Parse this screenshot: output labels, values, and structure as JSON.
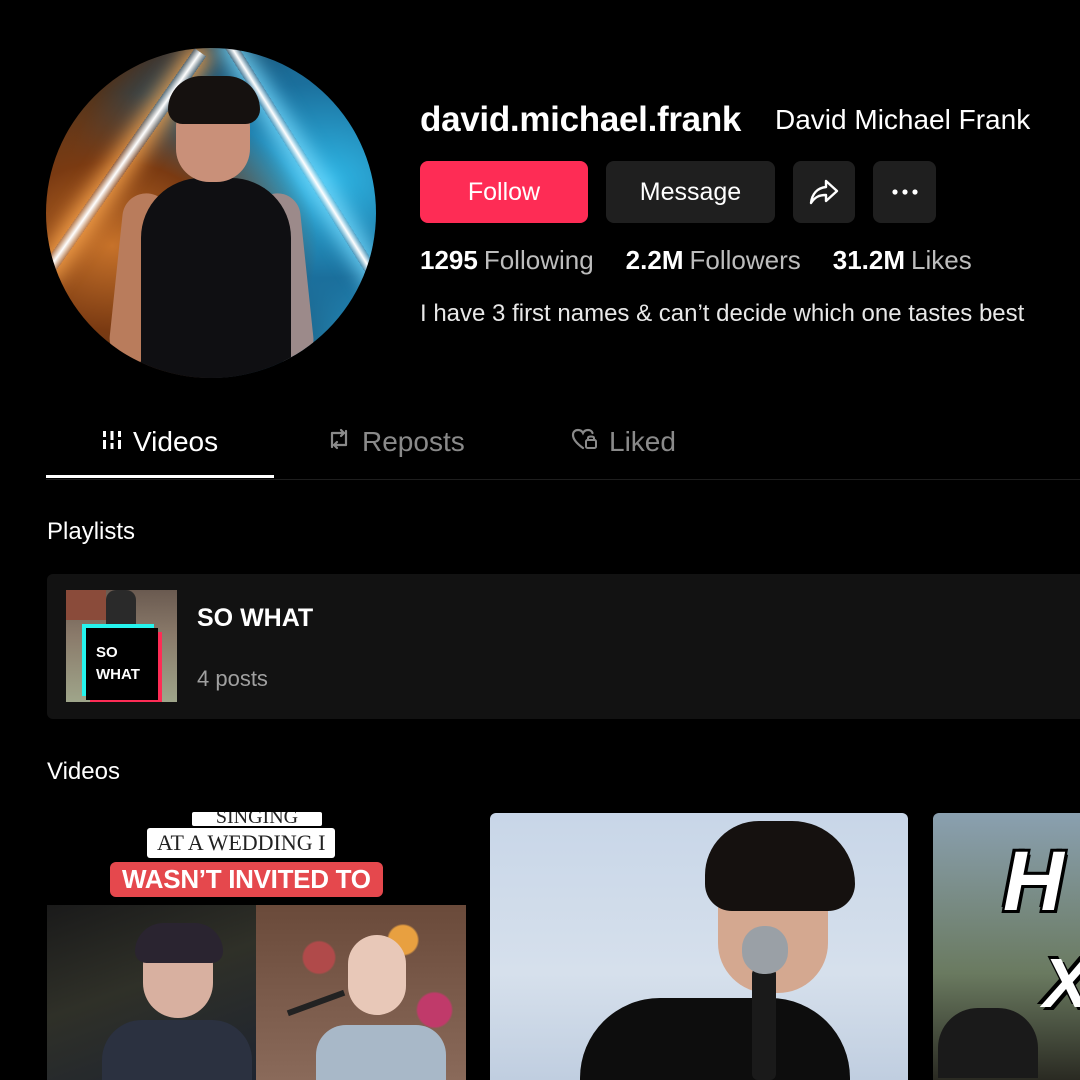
{
  "profile": {
    "username": "david.michael.frank",
    "display_name": "David Michael Frank",
    "bio": "I have 3 first names & can’t decide which one tastes best"
  },
  "actions": {
    "follow_label": "Follow",
    "message_label": "Message",
    "share_icon": "share-icon",
    "more_icon": "more-icon"
  },
  "stats": {
    "following": {
      "value": "1295",
      "label": "Following"
    },
    "followers": {
      "value": "2.2M",
      "label": "Followers"
    },
    "likes": {
      "value": "31.2M",
      "label": "Likes"
    }
  },
  "tabs": [
    {
      "label": "Videos",
      "icon": "grid-icon",
      "active": true
    },
    {
      "label": "Reposts",
      "icon": "repost-icon",
      "active": false
    },
    {
      "label": "Liked",
      "icon": "heart-lock-icon",
      "active": false
    }
  ],
  "playlists": {
    "section_title": "Playlists",
    "items": [
      {
        "title": "SO WHAT",
        "count": "4 posts",
        "thumb_line1": "SO",
        "thumb_line2": "WHAT"
      }
    ]
  },
  "videos": {
    "section_title": "Videos",
    "items": [
      {
        "caption_top": "SINGING",
        "caption_mid": "AT A WEDDING I",
        "caption_red": "WASN’T INVITED TO"
      },
      {},
      {
        "caption_a": "H",
        "caption_b": "X"
      }
    ]
  },
  "colors": {
    "background": "#000000",
    "follow_button": "#fe2c55",
    "secondary_button": "#1f1f1f",
    "muted_text": "#8a8a8a"
  }
}
